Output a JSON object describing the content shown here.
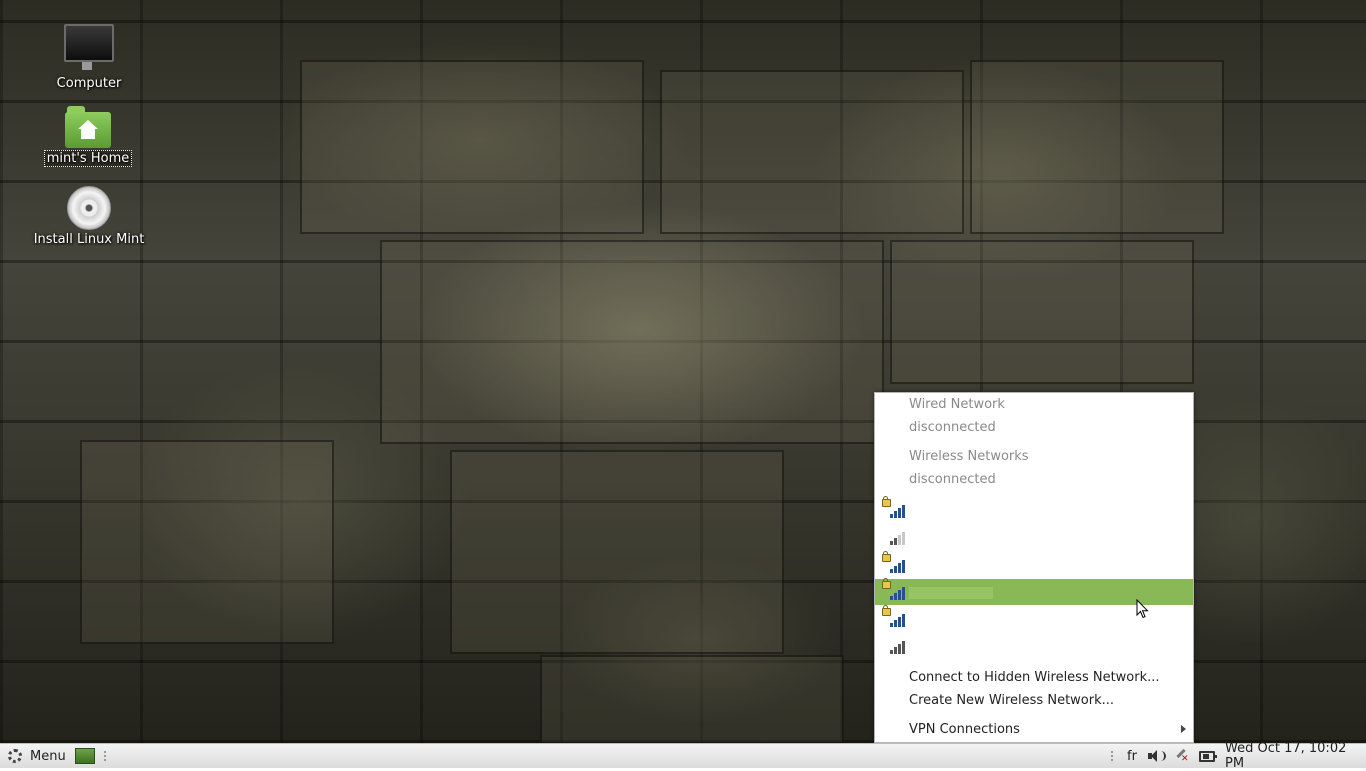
{
  "desktop": {
    "icons": [
      {
        "label": "Computer",
        "icon": "computer-icon"
      },
      {
        "label": "mint's Home",
        "icon": "home-folder-icon"
      },
      {
        "label": "Install Linux Mint",
        "icon": "disc-icon"
      }
    ]
  },
  "network_menu": {
    "wired_header": "Wired Network",
    "wired_status": "disconnected",
    "wireless_header": "Wireless Networks",
    "wireless_status": "disconnected",
    "networks": [
      {
        "secured": true,
        "signal_bars": 4,
        "hovered": false
      },
      {
        "secured": false,
        "signal_bars": 2,
        "hovered": false
      },
      {
        "secured": true,
        "signal_bars": 4,
        "hovered": false
      },
      {
        "secured": true,
        "signal_bars": 4,
        "hovered": true
      },
      {
        "secured": true,
        "signal_bars": 4,
        "hovered": false
      },
      {
        "secured": false,
        "signal_bars": 4,
        "hovered": false
      }
    ],
    "connect_hidden": "Connect to Hidden Wireless Network...",
    "create_new": "Create New Wireless Network...",
    "vpn": "VPN Connections"
  },
  "taskbar": {
    "menu_label": "Menu",
    "keyboard_layout": "fr",
    "clock": "Wed Oct 17, 10:02 PM"
  },
  "colors": {
    "menu_hover": "#89b856",
    "signal_active": "#2a4f8f",
    "signal_inactive": "#c8c8c8"
  }
}
